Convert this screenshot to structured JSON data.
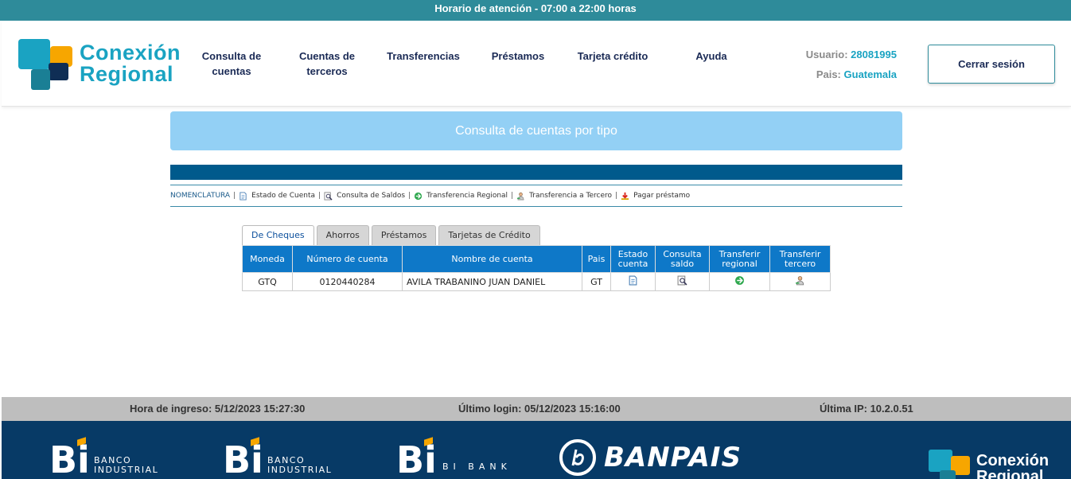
{
  "top_banner": "Horario de atención - 07:00 a 22:00 horas",
  "brand": {
    "line1": "Conexión",
    "line2": "Regional"
  },
  "nav": {
    "consulta_l1": "Consulta de",
    "consulta_l2": "cuentas",
    "terceros_l1": "Cuentas de",
    "terceros_l2": "terceros",
    "transferencias": "Transferencias",
    "prestamos": "Préstamos",
    "tarjeta": "Tarjeta crédito",
    "ayuda": "Ayuda"
  },
  "user": {
    "usuario_label": "Usuario:",
    "usuario_value": "28081995",
    "pais_label": "Pais:",
    "pais_value": "Guatemala"
  },
  "logout_label": "Cerrar sesión",
  "page_title": "Consulta de cuentas por tipo",
  "nomenclatura": {
    "label": "NOMENCLATURA",
    "estado": "Estado de Cuenta",
    "saldos": "Consulta de Saldos",
    "regional": "Transferencia Regional",
    "tercero": "Transferencia a Tercero",
    "prestamo": "Pagar préstamo"
  },
  "tabs": [
    "De Cheques",
    "Ahorros",
    "Préstamos",
    "Tarjetas de Crédito"
  ],
  "table": {
    "headers": {
      "moneda": "Moneda",
      "numero": "Número de cuenta",
      "nombre": "Nombre de cuenta",
      "pais": "Pais",
      "estado_l1": "Estado",
      "estado_l2": "cuenta",
      "saldo_l1": "Consulta",
      "saldo_l2": "saldo",
      "regional_l1": "Transferir",
      "regional_l2": "regional",
      "tercero_l1": "Transferir",
      "tercero_l2": "tercero"
    },
    "rows": [
      {
        "moneda": "GTQ",
        "numero": "0120440284",
        "nombre": "AVILA TRABANINO JUAN DANIEL",
        "pais": "GT"
      }
    ]
  },
  "session_info": {
    "hora_ingreso": "Hora de ingreso: 5/12/2023 15:27:30",
    "ultimo_login": "Último login: 05/12/2023 15:16:00",
    "ultima_ip": "Última IP: 10.2.0.51"
  },
  "footer": {
    "bi1_l1": "BANCO",
    "bi1_l2": "INDUSTRIAL",
    "bi2_l1": "BANCO",
    "bi2_l2": "INDUSTRIAL",
    "bi3": "BI BANK",
    "banpais": "BANPAIS",
    "brand_l1": "Conexión",
    "brand_l2": "Regional"
  },
  "colors": {
    "teal": "#2e8b9a",
    "brand_cyan": "#1aa3c2",
    "navy": "#073a66",
    "table_header": "#0e78c8",
    "title_box": "#93d0f5",
    "accent_orange": "#f7a600"
  },
  "icons": [
    "document-icon",
    "magnifier-icon",
    "transfer-regional-icon",
    "person-transfer-icon",
    "pay-loan-icon"
  ]
}
